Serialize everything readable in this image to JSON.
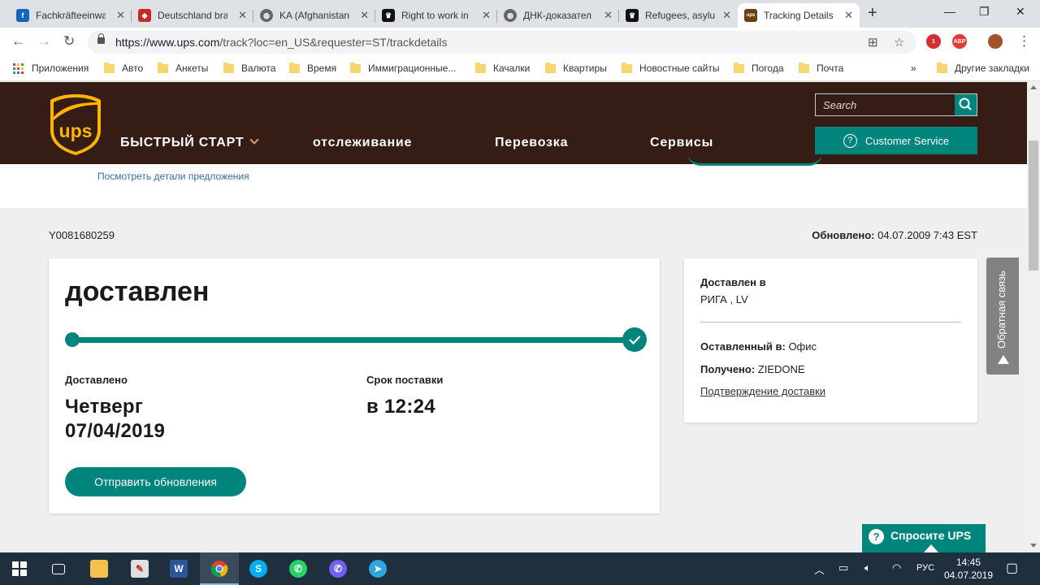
{
  "browser": {
    "tabs": [
      {
        "title": "Fachkräfteeinwa",
        "icon": "globe-blue-icon",
        "color": "#1565c0",
        "glyph": "f"
      },
      {
        "title": "Deutschland bra",
        "icon": "flag-icon",
        "color": "#c62828",
        "glyph": "◆"
      },
      {
        "title": "KA (Afghanistan",
        "icon": "globe-gray-icon",
        "color": "#666666",
        "glyph": "◍"
      },
      {
        "title": "Right to work in",
        "icon": "crown-icon",
        "color": "#111111",
        "glyph": "♛"
      },
      {
        "title": "ДНК-доказател",
        "icon": "globe-gray-icon",
        "color": "#666666",
        "glyph": "◍"
      },
      {
        "title": "Refugees, asylu",
        "icon": "crown-icon",
        "color": "#111111",
        "glyph": "♛"
      },
      {
        "title": "Tracking Details",
        "icon": "ups-icon",
        "color": "#6b3f12",
        "glyph": "ups"
      }
    ],
    "url_host": "https://www.ups.com",
    "url_path": "/track?loc=en_US&requester=ST/trackdetails",
    "ext_badge": "1",
    "abp_label": "ABP",
    "bookmarks": {
      "apps": "Приложения",
      "folders": [
        "Авто",
        "Анкеты",
        "Валюта",
        "Время",
        "Иммиграционные...",
        "Качалки",
        "Квартиры",
        "Новостные сайты",
        "Погода",
        "Почта"
      ],
      "overflow": "»",
      "other": "Другие закладки"
    }
  },
  "ups": {
    "nav": [
      "БЫСТРЫЙ СТАРТ",
      "отслеживание",
      "Перевозка",
      "Сервисы"
    ],
    "search_placeholder": "Search",
    "customer_service": "Customer Service",
    "promo_link": "Посмотреть детали предложения",
    "tracking_number": "Y0081680259",
    "updated_label": "Обновлено:",
    "updated_value": "04.07.2009 7:43 EST",
    "status": "доставлен",
    "progress": 1.0,
    "delivered_label": "Доставлено",
    "delivered_day": "Четверг",
    "delivered_date": "07/04/2019",
    "time_label": "Срок поставки",
    "time_value": "в 12:24",
    "send_updates": "Отправить обновления",
    "delivered_to_label": "Доставлен в",
    "delivered_to_value": "РИГА , LV",
    "left_at_label": "Оставленный в:",
    "left_at_value": "Офис",
    "received_label": "Получено:",
    "received_value": "ZIEDONE",
    "proof_link": "Подтверждение доставки",
    "feedback": "Обратная связь",
    "ask": "Спросите UPS",
    "brand_color": "#351c15",
    "accent_color": "#00857d"
  },
  "taskbar": {
    "lang": "РУС",
    "time": "14:45",
    "date": "04.07.2019"
  }
}
